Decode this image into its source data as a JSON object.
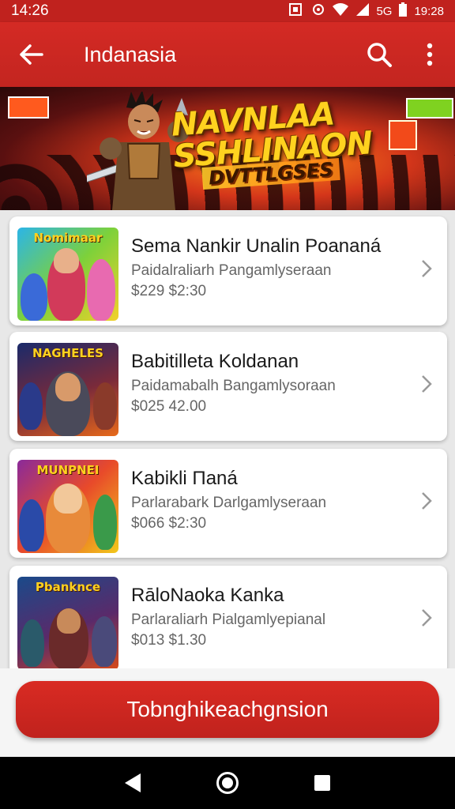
{
  "status_bar": {
    "time_left": "14:26",
    "icons_text": "5G",
    "time_right": "19:28"
  },
  "app_bar": {
    "title": "Indanasia"
  },
  "banner": {
    "title_line1": "NAVNLAA",
    "title_line2": "SSHLINAON",
    "subtitle": "DVTTLGSES"
  },
  "items": [
    {
      "name": "Sema Nankir Unalin Poananá",
      "desc": "Paidalraliarh Pangamlyseraan",
      "price": "$229 $2:30",
      "thumb_text": "Nomimaar"
    },
    {
      "name": "Babitilleta Koldanan",
      "desc": "Paidamabalh Bangamlysoraan",
      "price": "$025 42.00",
      "thumb_text": "NAGHELES"
    },
    {
      "name": "Kabikli Πaná",
      "desc": "Parlarabark Darlgamlyseraan",
      "price": "$066 $2:30",
      "thumb_text": "MUNPNEI"
    },
    {
      "name": "RāloNaoka Kanka",
      "desc": "Parlaraliarh Pialgamlyepianal",
      "price": "$013 $1.30",
      "thumb_text": "Pbanknce"
    }
  ],
  "cta": {
    "label": "Tobnghikeachgnsion"
  },
  "colors": {
    "primary": "#c32520",
    "card_bg": "#ffffff"
  }
}
